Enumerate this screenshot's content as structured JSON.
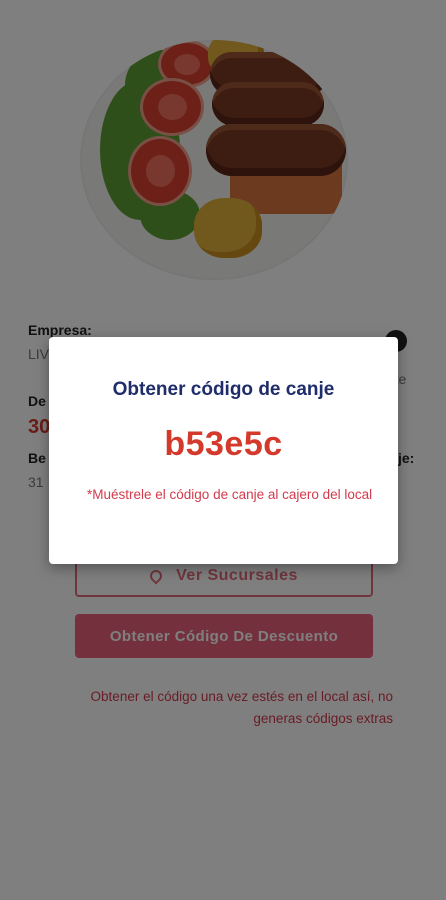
{
  "detail": {
    "company_label": "Empresa:",
    "company_value": "LIV",
    "right_snippet": "rte",
    "discount_label": "De",
    "price": "30",
    "benefit_label": "Be",
    "benefit_right": "je:",
    "date_value": "31"
  },
  "buttons": {
    "branches": "Ver Sucursales",
    "get_discount": "Obtener Código De Descuento"
  },
  "hint": "Obtener el código una vez estés en el local así, no generas códigos extras",
  "dialog": {
    "title": "Obtener código de canje",
    "code": "b53e5c",
    "note": "*Muéstrele el código de canje al cajero del local"
  },
  "colors": {
    "accent": "#d33a2c",
    "button_fill": "#e8617a",
    "title_blue": "#1f2d6b"
  },
  "icons": [
    "location-pin-icon",
    "info-icon"
  ]
}
